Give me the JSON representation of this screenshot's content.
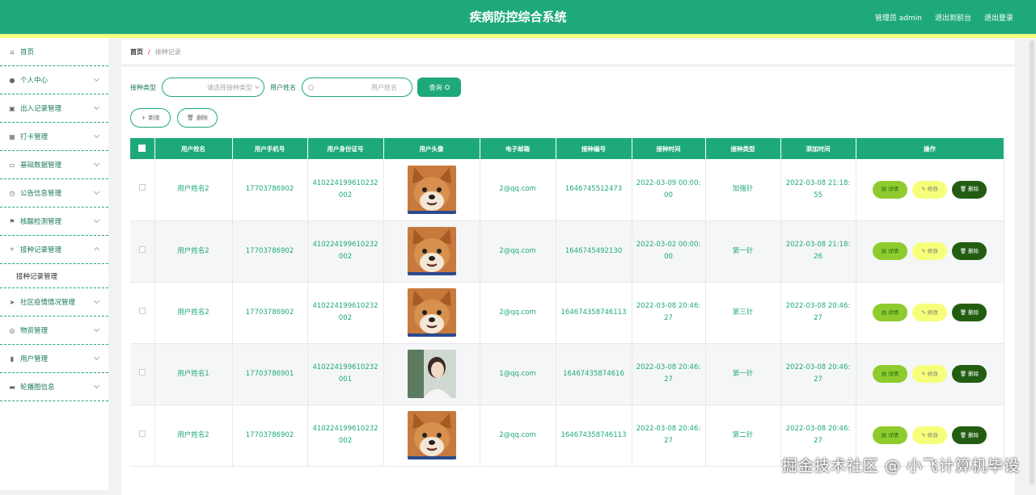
{
  "header": {
    "title": "疾病防控综合系统",
    "admin_label": "管理员 admin",
    "back_link": "退出到前台",
    "logout_link": "退出登录"
  },
  "sidebar": {
    "items": [
      {
        "label": "首页",
        "icon": "home-icon"
      },
      {
        "label": "个人中心",
        "icon": "user-icon"
      },
      {
        "label": "出入记录管理",
        "icon": "briefcase-icon"
      },
      {
        "label": "打卡管理",
        "icon": "grid-icon"
      },
      {
        "label": "基础数据管理",
        "icon": "message-icon"
      },
      {
        "label": "公告信息管理",
        "icon": "clock-icon"
      },
      {
        "label": "核酸检测管理",
        "icon": "flag-icon"
      },
      {
        "label": "接种记录管理",
        "icon": "crop-icon"
      },
      {
        "label": "社区疫情情况管理",
        "icon": "send-icon"
      },
      {
        "label": "物资管理",
        "icon": "compass-icon"
      },
      {
        "label": "用户管理",
        "icon": "chart-icon"
      },
      {
        "label": "轮播图信息",
        "icon": "comment-icon"
      }
    ],
    "submenu_label": "接种记录管理"
  },
  "breadcrumb": {
    "home": "首页",
    "separator": "/",
    "current": "接种记录"
  },
  "search": {
    "type_label": "接种类型",
    "type_placeholder": "请选择接种类型",
    "name_label": "用户姓名",
    "name_placeholder": "用户姓名",
    "button": "查询"
  },
  "actions": {
    "add": "新增",
    "delete": "删除"
  },
  "table": {
    "headers": [
      "用户姓名",
      "用户手机号",
      "用户身份证号",
      "用户头像",
      "电子邮箱",
      "接种编号",
      "接种时间",
      "接种类型",
      "添加时间",
      "操作"
    ],
    "rows": [
      {
        "name": "用户姓名2",
        "phone": "17703786902",
        "idcard": "410224199610232002",
        "avatar": "shiba",
        "email": "2@qq.com",
        "number": "1646745512473",
        "time": "2022-03-09 00:00:00",
        "type": "加强针",
        "added": "2022-03-08 21:18:55"
      },
      {
        "name": "用户姓名2",
        "phone": "17703786902",
        "idcard": "410224199610232002",
        "avatar": "shiba",
        "email": "2@qq.com",
        "number": "1646745492130",
        "time": "2022-03-02 00:00:00",
        "type": "第一针",
        "added": "2022-03-08 21:18:26"
      },
      {
        "name": "用户姓名2",
        "phone": "17703786902",
        "idcard": "410224199610232002",
        "avatar": "shiba",
        "email": "2@qq.com",
        "number": "164674358746113",
        "time": "2022-03-08 20:46:27",
        "type": "第三针",
        "added": "2022-03-08 20:46:27"
      },
      {
        "name": "用户姓名1",
        "phone": "17703786901",
        "idcard": "410224199610232001",
        "avatar": "girl",
        "email": "1@qq.com",
        "number": "16467435874616",
        "time": "2022-03-08 20:46:27",
        "type": "第一针",
        "added": "2022-03-08 20:46:27"
      },
      {
        "name": "用户姓名2",
        "phone": "17703786902",
        "idcard": "410224199610232002",
        "avatar": "shiba",
        "email": "2@qq.com",
        "number": "164674358746113",
        "time": "2022-03-08 20:46:27",
        "type": "第二针",
        "added": "2022-03-08 20:46:27"
      }
    ],
    "op_detail": "详情",
    "op_edit": "修改",
    "op_delete": "删除"
  },
  "watermark": "掘金技术社区 @ 小飞计算机毕设"
}
